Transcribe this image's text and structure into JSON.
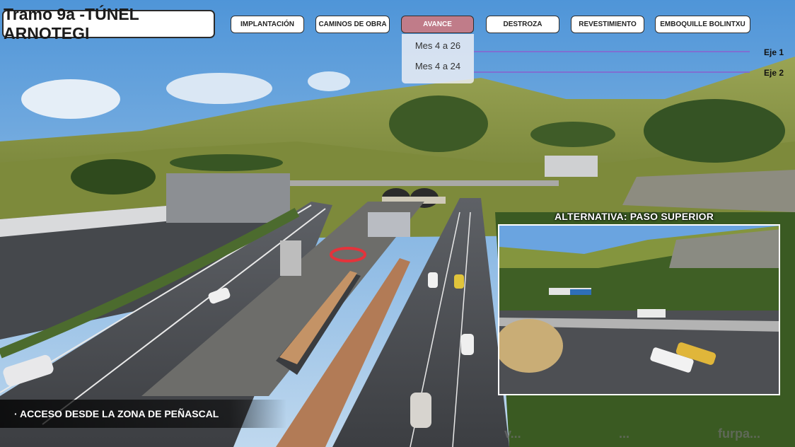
{
  "title": "Tramo 9a -TÚNEL ARNOTEGI",
  "nav": {
    "items": [
      {
        "label": "IMPLANTACIÓN"
      },
      {
        "label": "CAMINOS DE OBRA"
      },
      {
        "label": "AVANCE"
      },
      {
        "label": "DESTROZA"
      },
      {
        "label": "REVESTIMIENTO"
      },
      {
        "label": "EMBOQUILLE BOLINTXU"
      }
    ],
    "active": "AVANCE",
    "active_color": "#c07c89"
  },
  "dropdown": {
    "items": [
      "Mes 4 a 26",
      "Mes 4 a 24"
    ]
  },
  "axes": [
    {
      "label": "Eje 1",
      "color": "#7f6fd1"
    },
    {
      "label": "Eje 2",
      "color": "#7f6fd1"
    }
  ],
  "inset": {
    "title": "ALTERNATIVA: PASO SUPERIOR"
  },
  "caption": "· ACCESO DESDE LA ZONA DE PEÑASCAL",
  "logos": [
    "v...",
    "...",
    "furpa..."
  ]
}
